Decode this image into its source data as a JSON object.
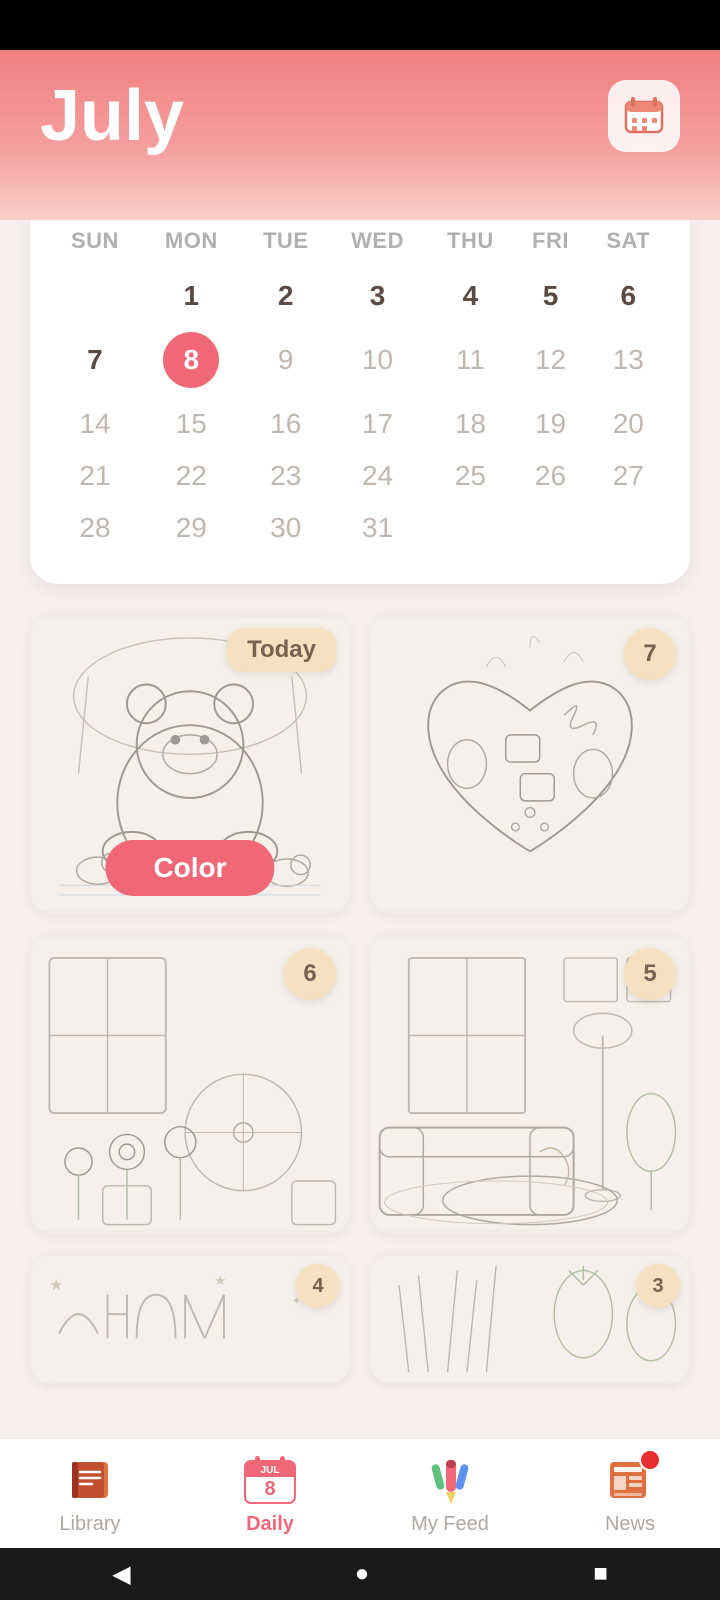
{
  "header": {
    "month": "July",
    "calendar_icon_label": "calendar"
  },
  "calendar": {
    "days_of_week": [
      "SUN",
      "MON",
      "TUE",
      "WED",
      "THU",
      "FRI",
      "SAT"
    ],
    "today": 8,
    "weeks": [
      [
        null,
        1,
        2,
        3,
        4,
        5,
        6
      ],
      [
        7,
        8,
        9,
        10,
        11,
        12,
        13
      ],
      [
        14,
        15,
        16,
        17,
        18,
        19,
        20
      ],
      [
        21,
        22,
        23,
        24,
        25,
        26,
        27
      ],
      [
        28,
        29,
        30,
        31,
        null,
        null,
        null
      ]
    ]
  },
  "coloring_cards": [
    {
      "badge": "Today",
      "badge_type": "today",
      "day_number": null,
      "has_color_button": true,
      "color_button_label": "Color",
      "sketch_type": "bear"
    },
    {
      "badge": "7",
      "badge_type": "day",
      "has_color_button": false,
      "sketch_type": "candy"
    },
    {
      "badge": "6",
      "badge_type": "day",
      "has_color_button": false,
      "sketch_type": "flowers"
    },
    {
      "badge": "5",
      "badge_type": "day",
      "has_color_button": false,
      "sketch_type": "interior"
    }
  ],
  "partial_cards": [
    {
      "badge": "4",
      "sketch_type": "happy"
    },
    {
      "badge": "3",
      "sketch_type": "plants"
    }
  ],
  "bottom_nav": {
    "items": [
      {
        "id": "library",
        "label": "Library",
        "icon": "📚",
        "active": false,
        "has_notification": false
      },
      {
        "id": "daily",
        "label": "Daily",
        "icon": "📅",
        "active": true,
        "has_notification": false
      },
      {
        "id": "myfeed",
        "label": "My Feed",
        "icon": "🎨",
        "active": false,
        "has_notification": false
      },
      {
        "id": "news",
        "label": "News",
        "icon": "📰",
        "active": false,
        "has_notification": true
      }
    ]
  },
  "sys_nav": {
    "back": "◀",
    "home": "●",
    "recents": "■"
  }
}
